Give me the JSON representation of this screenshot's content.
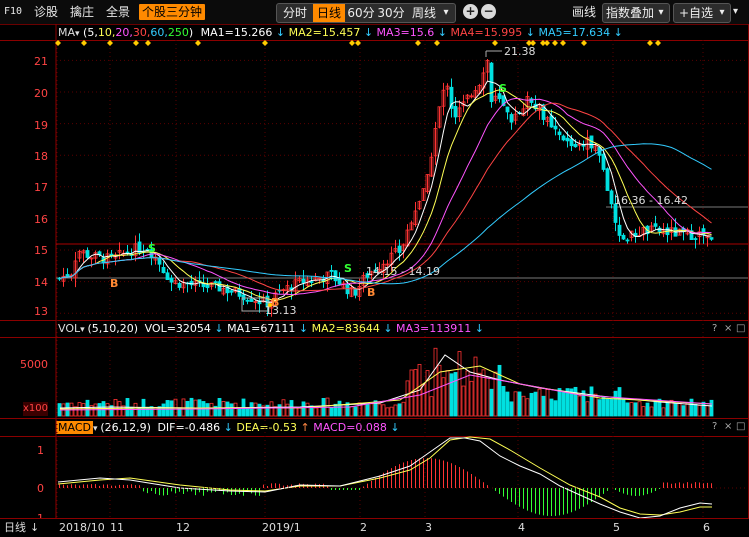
{
  "toolbar": {
    "f10": "F10",
    "items": [
      "诊股",
      "擒庄",
      "全景"
    ],
    "active_item": "个股三分钟",
    "periods": [
      "分时",
      "日线",
      "60分",
      "30分",
      "周线"
    ],
    "active_period": "日线",
    "dropdown_arrow": "▾",
    "zoom_plus": "+",
    "zoom_minus": "−",
    "draw_label": "画线",
    "index_overlay_label": "指数叠加",
    "watchlist_label": "+自选"
  },
  "price_panel": {
    "indicator_name": "MA",
    "params_open": "(5,",
    "params_list": [
      "10,",
      "20,",
      "30,",
      "60,",
      "250"
    ],
    "params_close": ")",
    "param_colors": [
      "#ffffff",
      "#ffff55",
      "#ff55ff",
      "#ff4444",
      "#33ccff",
      "#33ff33"
    ],
    "ma_values": [
      {
        "label": "MA1=15.266",
        "color": "#ffffff"
      },
      {
        "label": "MA2=15.457",
        "color": "#ffff55"
      },
      {
        "label": "MA3=15.6",
        "color": "#ff55ff"
      },
      {
        "label": "MA4=15.995",
        "color": "#ff4444"
      },
      {
        "label": "MA5=17.634",
        "color": "#33ccff"
      }
    ],
    "y_ticks": [
      "21",
      "20",
      "19",
      "18",
      "17",
      "16",
      "15",
      "14",
      "13"
    ],
    "high_label": "21.38",
    "low_label": "13.13",
    "range_labels": [
      "16.36 - 16.42",
      "14.15 - 14.19"
    ],
    "signals": [
      {
        "text": "S",
        "color": "#33ff33"
      },
      {
        "text": "B",
        "color": "#ff8833"
      },
      {
        "text": "S",
        "color": "#33ff33"
      },
      {
        "text": "B",
        "color": "#ff8833"
      },
      {
        "text": "B",
        "color": "#ff8833"
      },
      {
        "text": "S",
        "color": "#33ff33"
      }
    ]
  },
  "volume_panel": {
    "indicator_name": "VOL",
    "params": "(5,10,20)",
    "values": [
      {
        "label": "VOL=32054",
        "color": "#ffffff"
      },
      {
        "label": "MA1=67111",
        "color": "#ffffff"
      },
      {
        "label": "MA2=83644",
        "color": "#ffff55"
      },
      {
        "label": "MA3=113911",
        "color": "#ff55ff"
      }
    ],
    "y_ticks": [
      "5000"
    ],
    "unit": "x100"
  },
  "macd_panel": {
    "indicator_name": "MACD",
    "params": "(26,12,9)",
    "values": [
      {
        "label": "DIF=-0.486",
        "color": "#ffffff"
      },
      {
        "label": "DEA=-0.53",
        "color": "#ffff55"
      },
      {
        "label": "MACD=0.088",
        "color": "#ff55ff"
      }
    ],
    "y_ticks": [
      "1",
      "0",
      "-1"
    ]
  },
  "panel_controls": [
    "?",
    "×",
    "□"
  ],
  "bottom_axis": {
    "period_label": "日线",
    "labels": [
      "2018/10",
      "11",
      "12",
      "2019/1",
      "2",
      "3",
      "4",
      "5",
      "6"
    ]
  },
  "colors": {
    "up": "#ff3333",
    "down": "#00e0e0",
    "frame": "#8b0000",
    "accent": "#ff8a00"
  }
}
